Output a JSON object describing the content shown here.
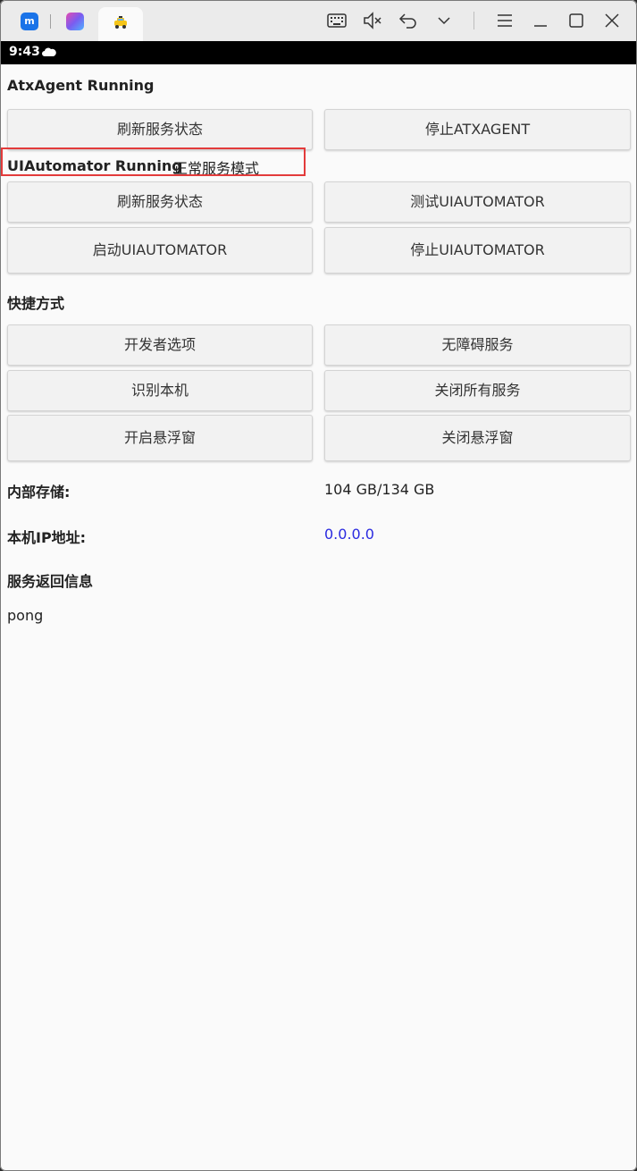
{
  "status_bar": {
    "time": "9:43"
  },
  "atx": {
    "status": "AtxAgent Running",
    "refresh_label": "刷新服务状态",
    "stop_label": "停止ATXAGENT"
  },
  "uiautomator": {
    "status": "UIAutomator Running",
    "mode": "正常服务模式",
    "refresh_label": "刷新服务状态",
    "test_label": "测试UIAUTOMATOR",
    "start_label": "启动UIAUTOMATOR",
    "stop_label": "停止UIAUTOMATOR"
  },
  "shortcuts": {
    "heading": "快捷方式",
    "developer_options": "开发者选项",
    "accessibility": "无障碍服务",
    "identify_device": "识别本机",
    "close_all": "关闭所有服务",
    "open_float": "开启悬浮窗",
    "close_float": "关闭悬浮窗"
  },
  "info": {
    "storage_label": "内部存储:",
    "storage_value": "104 GB/134 GB",
    "ip_label": "本机IP地址:",
    "ip_value": "0.0.0.0",
    "response_heading": "服务返回信息",
    "response_value": "pong"
  },
  "colors": {
    "highlight": "#e33b3b",
    "ip_link": "#2a2ae0"
  }
}
